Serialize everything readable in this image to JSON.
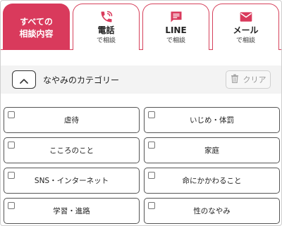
{
  "tabs": [
    {
      "line1": "すべての",
      "line2": "相談内容",
      "active": true
    },
    {
      "title": "電話",
      "sub": "で相談",
      "icon": "phone-icon"
    },
    {
      "title": "LINE",
      "sub": "で相談",
      "icon": "chat-icon"
    },
    {
      "title": "メール",
      "sub": "で相談",
      "icon": "mail-icon"
    }
  ],
  "category": {
    "title": "なやみのカテゴリー",
    "clear_label": "クリア"
  },
  "items": [
    {
      "label": "虐待"
    },
    {
      "label": "いじめ・体罰"
    },
    {
      "label": "こころのこと"
    },
    {
      "label": "家庭"
    },
    {
      "label": "SNS・インターネット"
    },
    {
      "label": "命にかかわること"
    },
    {
      "label": "学習・進路"
    },
    {
      "label": "性のなやみ"
    }
  ],
  "colors": {
    "accent": "#d93a5c",
    "accent_border": "#d6415b"
  }
}
